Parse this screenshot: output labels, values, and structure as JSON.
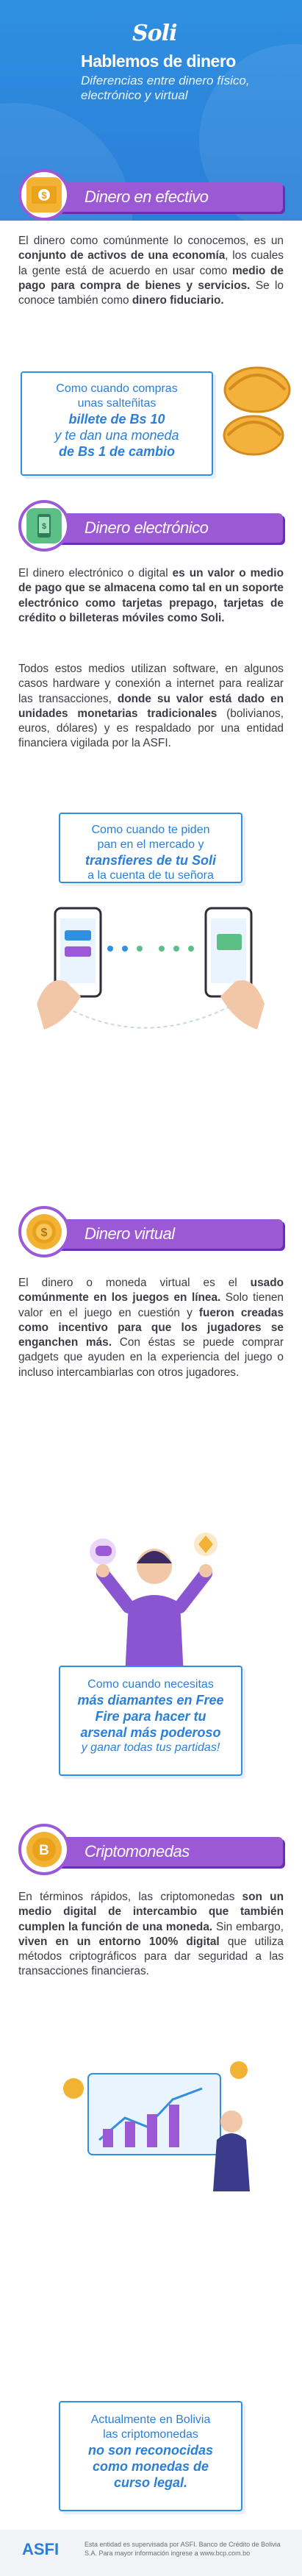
{
  "header": {
    "logo": "Soli",
    "title": "Hablemos de dinero",
    "subtitle": "Diferencias entre dinero físico, electrónico y virtual"
  },
  "sections": [
    {
      "heading": "Dinero en efectivo",
      "icon": "banknote-icon",
      "paragraph_parts": [
        {
          "t": "El dinero como comúnmente lo conocemos, es un ",
          "b": false
        },
        {
          "t": "conjunto de activos de una economía",
          "b": true
        },
        {
          "t": ", los cuales la gente está de acuerdo en usar como ",
          "b": false
        },
        {
          "t": "medio de pago para compra de bienes y servicios.",
          "b": true
        },
        {
          "t": " Se lo conoce también como ",
          "b": false
        },
        {
          "t": "dinero fiduciario.",
          "b": true
        }
      ],
      "callout": {
        "lines": [
          "Como cuando compras",
          "unas salteñitas"
        ],
        "emph": [
          "billete de Bs 10",
          "y te dan una moneda",
          "de Bs 1 de cambio"
        ]
      }
    },
    {
      "heading": "Dinero electrónico",
      "icon": "phone-money-icon",
      "paragraph_parts": [
        {
          "t": "El dinero electrónico o digital ",
          "b": false
        },
        {
          "t": "es un valor o medio de pago que se almacena como tal en un soporte electrónico como tarjetas prepago, tarjetas de crédito o billeteras móviles como Soli.",
          "b": true
        }
      ],
      "paragraph2_parts": [
        {
          "t": "Todos estos medios utilizan software, en algunos casos hardware y conexión a internet para realizar las transacciones, ",
          "b": false
        },
        {
          "t": "donde su valor está dado en unidades monetarias tradicionales",
          "b": true
        },
        {
          "t": " (bolivianos, euros, dólares) y es respaldado por una entidad financiera vigilada por la ASFI.",
          "b": false
        }
      ],
      "callout": {
        "lines": [
          "Como cuando te piden",
          "pan en el mercado y"
        ],
        "emph": [
          "transfieres de tu Soli"
        ],
        "tail": [
          "a la cuenta de tu señora"
        ]
      }
    },
    {
      "heading": "Dinero virtual",
      "icon": "coin-icon",
      "paragraph_parts": [
        {
          "t": "El dinero o moneda virtual es el ",
          "b": false
        },
        {
          "t": "usado comúnmente en los juegos en línea.",
          "b": true
        },
        {
          "t": " Solo tienen valor en el juego en cuestión y ",
          "b": false
        },
        {
          "t": "fueron creadas como incentivo para que los jugadores se enganchen más.",
          "b": true
        },
        {
          "t": " Con éstas se puede comprar gadgets que ayuden en la experiencia del juego o incluso intercambiarlas con otros jugadores.",
          "b": false
        }
      ],
      "callout": {
        "lines": [
          "Como cuando necesitas"
        ],
        "emph": [
          "más diamantes en Free",
          "Fire para hacer tu",
          "arsenal más poderoso"
        ],
        "tail": [
          "y ganar todas tus partidas!"
        ]
      }
    },
    {
      "heading": "Criptomonedas",
      "icon": "bitcoin-icon",
      "paragraph_parts": [
        {
          "t": "En términos rápidos, las criptomonedas ",
          "b": false
        },
        {
          "t": "son un medio digital de intercambio que también cumplen la función de una moneda.",
          "b": true
        },
        {
          "t": " Sin embargo, ",
          "b": false
        },
        {
          "t": "viven en un entorno 100% digital",
          "b": true
        },
        {
          "t": " que utiliza métodos criptográficos para dar seguridad a las transacciones financieras.",
          "b": false
        }
      ],
      "callout": {
        "lines": [
          "Actualmente en Bolivia",
          "las criptomonedas"
        ],
        "emph": [
          "no son reconocidas",
          "como monedas de",
          "curso legal."
        ]
      }
    }
  ],
  "footer": {
    "logo": "ASFI",
    "note": "Esta entidad es supervisada por ASFI. Banco de Crédito de Bolivia S.A. Para mayor información ingrese a www.bcp.com.bo"
  },
  "colors": {
    "blue": "#2f8fe0",
    "purple": "#9b59d6",
    "gold": "#f2b233"
  }
}
